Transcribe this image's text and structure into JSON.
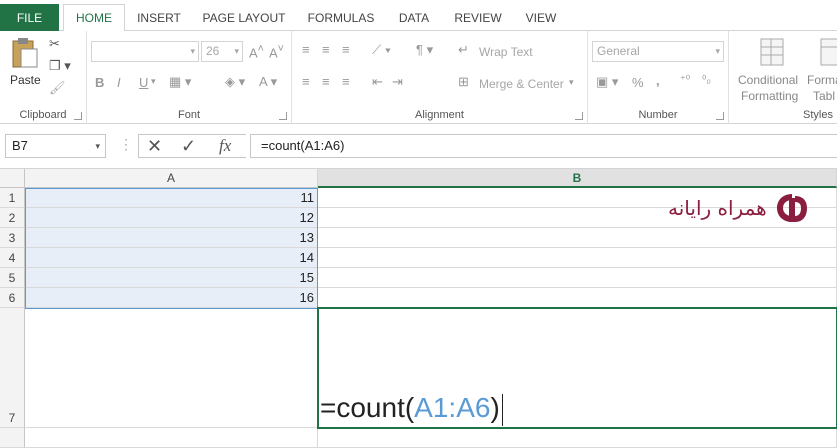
{
  "tabs": {
    "file": "FILE",
    "home": "HOME",
    "insert": "INSERT",
    "page_layout": "PAGE LAYOUT",
    "formulas": "FORMULAS",
    "data": "DATA",
    "review": "REVIEW",
    "view": "VIEW"
  },
  "ribbon": {
    "clipboard": {
      "paste": "Paste",
      "label": "Clipboard"
    },
    "font": {
      "size": "26",
      "bold": "B",
      "italic": "I",
      "underline": "U",
      "label": "Font"
    },
    "alignment": {
      "wrap_text": "Wrap Text",
      "merge_center": "Merge & Center",
      "label": "Alignment"
    },
    "number": {
      "format": "General",
      "percent": "%",
      "comma": ",",
      "label": "Number"
    },
    "styles": {
      "conditional_1": "Conditional",
      "conditional_2": "Formatting",
      "format_1": "Forma",
      "format_2": "Tabl",
      "label": "Styles"
    }
  },
  "formula_bar": {
    "name_box": "B7",
    "fx": "fx",
    "formula": "=count(A1:A6)"
  },
  "grid": {
    "col_a": "A",
    "col_b": "B",
    "rows": [
      "1",
      "2",
      "3",
      "4",
      "5",
      "6",
      "7"
    ],
    "values": [
      "11",
      "12",
      "13",
      "14",
      "15",
      "16"
    ],
    "b7_prefix": "=count(",
    "b7_ref": "A1:A6",
    "b7_suffix": ")"
  },
  "brand": {
    "name": "همراه رایانه",
    "accent": "#8b1e3f"
  },
  "colors": {
    "excel_green": "#217346",
    "ref_blue": "#5b9bd5"
  }
}
